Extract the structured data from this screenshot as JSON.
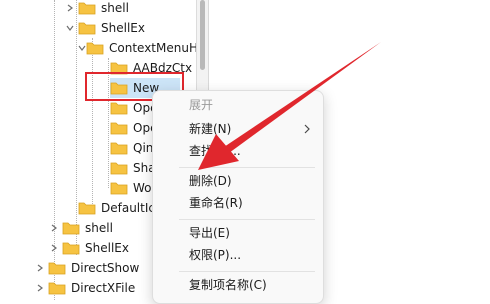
{
  "tree": {
    "items": [
      {
        "label": "shell"
      },
      {
        "label": "ShellEx"
      },
      {
        "label": "ContextMenuHandlers"
      },
      {
        "label": "AABdzCtx"
      },
      {
        "label": "New"
      },
      {
        "label": "Open"
      },
      {
        "label": "OpenWith"
      },
      {
        "label": "QingNiao"
      },
      {
        "label": "Sharing"
      },
      {
        "label": "WorkFolders"
      },
      {
        "label": "DefaultIcon"
      },
      {
        "label": "shell"
      },
      {
        "label": "ShellEx"
      },
      {
        "label": "DirectShow"
      },
      {
        "label": "DirectXFile"
      }
    ],
    "selected_label": "New"
  },
  "context_menu": {
    "expand": "展开",
    "new": "新建(N)",
    "find": "查找(F)...",
    "delete": "删除(D)",
    "rename": "重命名(R)",
    "export": "导出(E)",
    "permissions": "权限(P)...",
    "copy_key_name": "复制项名称(C)"
  },
  "colors": {
    "highlight_border": "#e0272d",
    "annotation_arrow": "#e0272d",
    "folder": "#f6c342",
    "selection": "#cce4f7"
  }
}
